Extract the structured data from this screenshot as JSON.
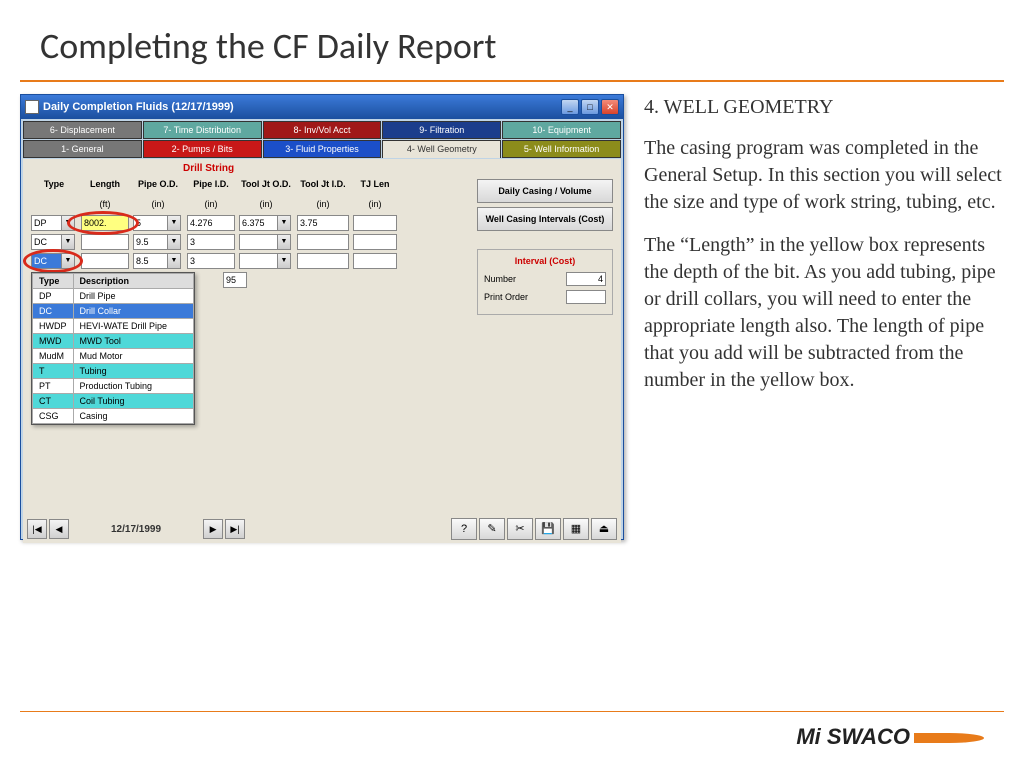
{
  "slide": {
    "title": "Completing the CF Daily Report"
  },
  "window": {
    "title": "Daily Completion Fluids (12/17/1999)"
  },
  "tabs_top": [
    "6- Displacement",
    "7- Time Distribution",
    "8- Inv/Vol Acct",
    "9- Filtration",
    "10- Equipment"
  ],
  "tabs_bot": [
    "1- General",
    "2- Pumps / Bits",
    "3- Fluid Properties",
    "4- Well Geometry",
    "5- Well Information"
  ],
  "section": {
    "title": "Drill String"
  },
  "headers": [
    "Type",
    "Length",
    "Pipe O.D.",
    "Pipe I.D.",
    "Tool Jt O.D.",
    "Tool Jt I.D.",
    "TJ Len"
  ],
  "units": [
    "",
    "(ft)",
    "(in)",
    "(in)",
    "(in)",
    "(in)",
    "(in)"
  ],
  "rows": [
    {
      "type": "DP",
      "len": "8002.",
      "od": "5",
      "id": "4.276",
      "tjod": "6.375",
      "tjid": "3.75",
      "tjlen": ""
    },
    {
      "type": "DC",
      "len": "",
      "od": "9.5",
      "id": "3",
      "tjod": "",
      "tjid": "",
      "tjlen": ""
    },
    {
      "type": "DC",
      "len": "",
      "od": "8.5",
      "id": "3",
      "tjod": "",
      "tjid": "",
      "tjlen": ""
    }
  ],
  "extra_id": "95",
  "type_popup": {
    "headers": [
      "Type",
      "Description"
    ],
    "rows": [
      {
        "t": "DP",
        "d": "Drill Pipe",
        "cls": ""
      },
      {
        "t": "DC",
        "d": "Drill Collar",
        "cls": "hl"
      },
      {
        "t": "HWDP",
        "d": "HEVI-WATE Drill Pipe",
        "cls": ""
      },
      {
        "t": "MWD",
        "d": "MWD Tool",
        "cls": "cyan"
      },
      {
        "t": "MudM",
        "d": "Mud Motor",
        "cls": ""
      },
      {
        "t": "T",
        "d": "Tubing",
        "cls": "cyan"
      },
      {
        "t": "PT",
        "d": "Production Tubing",
        "cls": ""
      },
      {
        "t": "CT",
        "d": "Coil Tubing",
        "cls": "cyan"
      },
      {
        "t": "CSG",
        "d": "Casing",
        "cls": ""
      }
    ]
  },
  "side": {
    "btn1": "Daily Casing / Volume",
    "btn2": "Well Casing Intervals (Cost)",
    "interval_title": "Interval (Cost)",
    "num_label": "Number",
    "num_val": "4",
    "print_label": "Print Order",
    "print_val": ""
  },
  "nav": {
    "date": "12/17/1999"
  },
  "explain": {
    "heading": "4. WELL GEOMETRY",
    "p1": "The casing program was completed in the General Setup. In this section you will select the size and type of work string, tubing, etc.",
    "p2": "The “Length” in the yellow box represents the depth of the bit. As you add tubing, pipe or drill collars, you will need to enter the appropriate length also. The length of pipe that you add will be subtracted from the number in the yellow box."
  },
  "logo": "Mi SWACO"
}
